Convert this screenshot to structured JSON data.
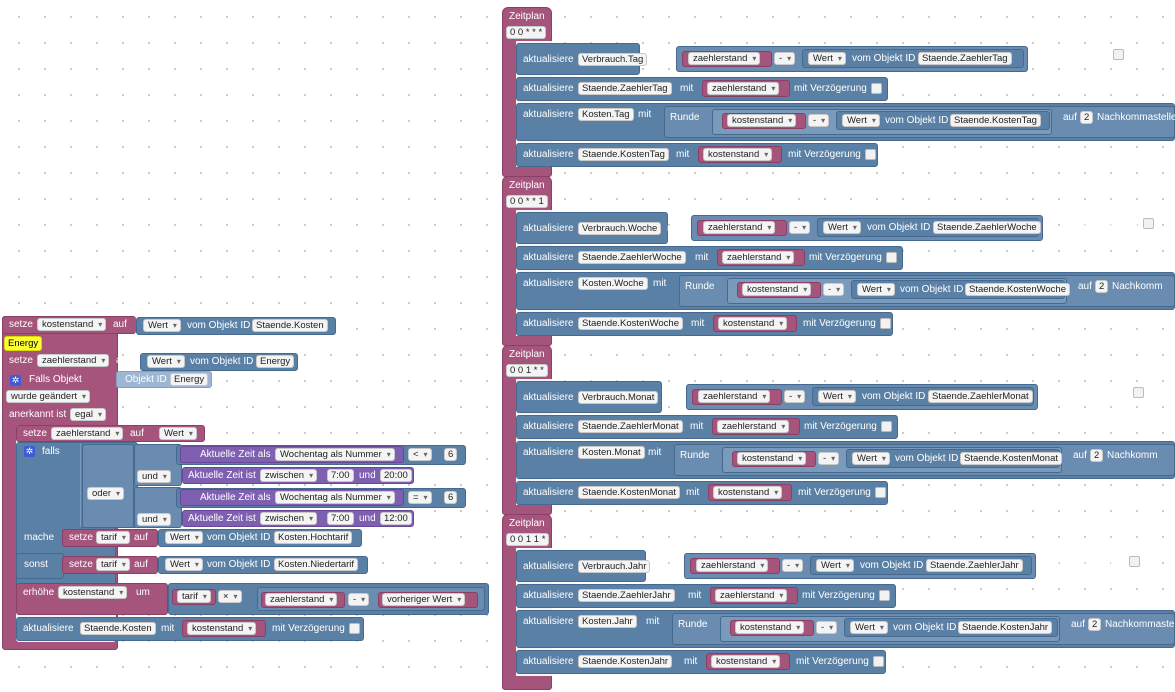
{
  "left_script": {
    "setze_label": "setze",
    "auf_label": "auf",
    "wert_option": "Wert",
    "vom_objekt_id_label": "vom Objekt ID",
    "var_kostenstand": "kostenstand",
    "var_zaehlerstand": "zaehlerstand",
    "var_tarif": "tarif",
    "obj_staende_kosten": "Staende.Kosten",
    "obj_energy_highlight": "Energy",
    "obj_energy": "Energy",
    "falls_objekt_label": "Falls Objekt",
    "objekt_id_label": "Objekt ID",
    "trigger_energy": "Energy",
    "wurde_geaendert": "wurde geändert",
    "anerkannt_ist_label": "anerkannt ist",
    "egal_option": "egal",
    "falls_label": "falls",
    "oder_option": "oder",
    "und_option": "und",
    "aktuelle_zeit_als": "Aktuelle Zeit als",
    "wochentag_als_nummer": "Wochentag als Nummer",
    "op_lt": "<",
    "op_eq": "=",
    "num_6a": "6",
    "num_6b": "6",
    "aktuelle_zeit_ist": "Aktuelle Zeit ist",
    "zwischen_option": "zwischen",
    "und_label": "und",
    "time_700a": "7:00",
    "time_2000": "20:00",
    "time_700b": "7:00",
    "time_1200": "12:00",
    "mache_label": "mache",
    "sonst_label": "sonst",
    "obj_hochtarif": "Kosten.Hochtarif",
    "obj_niedertarif": "Kosten.Niedertarif",
    "erhoehe_label": "erhöhe",
    "um_label": "um",
    "op_mul": "×",
    "op_minus": "-",
    "vorheriger_wert": "vorheriger Wert",
    "aktualisiere_label": "aktualisiere",
    "mit_label": "mit",
    "mit_verzoegerung": "mit Verzögerung"
  },
  "zeitplan": [
    {
      "title": "Zeitplan",
      "cron": "0 0 * * *",
      "verbrauch": "Verbrauch.Tag",
      "staende_zaehler": "Staende.ZaehlerTag",
      "kosten": "Kosten.Tag",
      "staende_kosten": "Staende.KostenTag",
      "nachkommastellen_label": "Nachkommastelle"
    },
    {
      "title": "Zeitplan",
      "cron": "0 0 * * 1",
      "verbrauch": "Verbrauch.Woche",
      "staende_zaehler": "Staende.ZaehlerWoche",
      "kosten": "Kosten.Woche",
      "staende_kosten": "Staende.KostenWoche",
      "nachkommastellen_label": "Nachkomm"
    },
    {
      "title": "Zeitplan",
      "cron": "0 0 1 * *",
      "verbrauch": "Verbrauch.Monat",
      "staende_zaehler": "Staende.ZaehlerMonat",
      "kosten": "Kosten.Monat",
      "staende_kosten": "Staende.KostenMonat",
      "nachkommastellen_label": "Nachkomm"
    },
    {
      "title": "Zeitplan",
      "cron": "0 0 1 1 *",
      "verbrauch": "Verbrauch.Jahr",
      "staende_zaehler": "Staende.ZaehlerJahr",
      "kosten": "Kosten.Jahr",
      "staende_kosten": "Staende.KostenJahr",
      "nachkommastellen_label": "Nachkommaste"
    }
  ],
  "zeitplan_common": {
    "aktualisiere_label": "aktualisiere",
    "mit_label": "mit",
    "zaehlerstand_var": "zaehlerstand",
    "kostenstand_var": "kostenstand",
    "minus_op": "-",
    "wert_option": "Wert",
    "vom_objekt_id_label": "vom Objekt ID",
    "mit_verzoegerung": "mit Verzögerung",
    "runde_label": "Runde",
    "auf_label": "auf",
    "digits": "2"
  },
  "colors": {
    "variables": "#a5547c",
    "actions": "#5b80a5",
    "logic": "#7f5fb0",
    "highlight": "#ffff33"
  }
}
